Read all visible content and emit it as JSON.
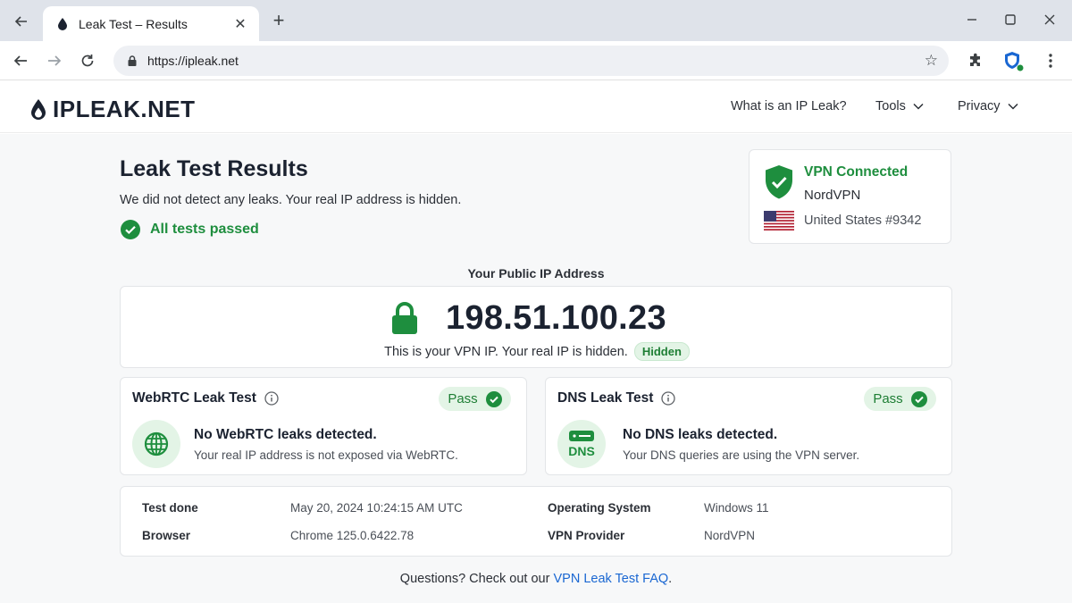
{
  "browser": {
    "tab_title": "Leak Test – Results",
    "url": "https://ipleak.net",
    "icons": [
      "back-arrow-icon",
      "close-icon",
      "plus-icon",
      "minimize-icon",
      "maximize-icon",
      "star-icon",
      "puzzle-icon",
      "shield-icon",
      "more-vert-icon",
      "forward-arrow-icon",
      "reload-icon",
      "lock-icon"
    ]
  },
  "site": {
    "logo": "IPLEAK.NET",
    "nav": {
      "what_is": "What is an IP Leak?",
      "tools": "Tools",
      "privacy": "Privacy"
    }
  },
  "results": {
    "title": "Leak Test Results",
    "subtitle": "We did not detect any leaks. Your real IP address is hidden.",
    "all_passed": "All tests passed"
  },
  "vpn": {
    "status": "VPN Connected",
    "provider": "NordVPN",
    "location": "United States #9342",
    "flag": "us-flag-icon"
  },
  "ip": {
    "label": "Your Public IP Address",
    "address": "198.51.100.23",
    "note": "This is your VPN IP. Your real IP is hidden.",
    "badge": "Hidden"
  },
  "webrtc": {
    "title": "WebRTC Leak Test",
    "status": "Pass",
    "message": "No WebRTC leaks detected.",
    "description": "Your real IP address is not exposed via WebRTC."
  },
  "dns": {
    "title": "DNS Leak Test",
    "status": "Pass",
    "message": "No DNS leaks detected.",
    "description": "Your DNS queries are using the VPN server.",
    "icon_label": "DNS"
  },
  "details": {
    "test_done_label": "Test done",
    "test_done": "May 20, 2024 10:24:15 AM UTC",
    "os_label": "Operating System",
    "os": "Windows 11",
    "browser_label": "Browser",
    "browser": "Chrome 125.0.6422.78",
    "vpn_provider_label": "VPN Provider",
    "vpn_provider": "NordVPN"
  },
  "footer": {
    "question": "Questions? Check out our",
    "link": "VPN Leak Test FAQ",
    "period": "."
  },
  "colors": {
    "success": "#1e8e3e",
    "link": "#1a67d2",
    "tabstrip": "#dfe3ea"
  }
}
